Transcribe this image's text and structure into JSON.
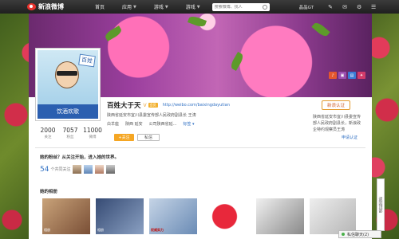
{
  "topbar": {
    "logo": "新浪微博",
    "nav": [
      {
        "label": "首页",
        "caret": false
      },
      {
        "label": "应用",
        "caret": true
      },
      {
        "label": "游戏",
        "caret": true
      },
      {
        "label": "游戏",
        "caret": true
      }
    ],
    "search_placeholder": "搜索微博、找人",
    "user": "晶晶GT",
    "icons": [
      "edit-icon",
      "mail-icon",
      "gear-icon",
      "list-icon"
    ]
  },
  "profile": {
    "avatar_caption": "饮酒欢歌",
    "avatar_tag": "百姓",
    "name": "百姓大于天",
    "vip_mark": "V",
    "vip_badge": "会员",
    "url": "http://weibo.com/baixingdayutian",
    "desc": "陕西省延安市宜川县委宣传部人民政府副县长 王涛",
    "meta": [
      {
        "label": "白羊座",
        "link": false
      },
      {
        "label": "陕西 延安",
        "link": false
      },
      {
        "label": "公司陕西省延...",
        "link": false
      },
      {
        "label": "标签 ▾",
        "link": true
      }
    ]
  },
  "stats": [
    {
      "num": "2000",
      "label": "关注"
    },
    {
      "num": "7057",
      "label": "粉丝"
    },
    {
      "num": "11000",
      "label": "微博"
    }
  ],
  "buttons": {
    "follow": "+关注",
    "message": "私信"
  },
  "verify": {
    "button": "新浪认证",
    "text": "陕西省延安市宜川县委宣传部人民政府副县长，新浪政企特约观察员王涛",
    "link": "申请认证"
  },
  "follow_prompt": "她的粉丝？从关注开始，进入她的世界。",
  "common": {
    "count": "54",
    "label": "个共同关注"
  },
  "section_title": "她的相册",
  "photos": [
    {
      "label": "相册"
    },
    {
      "label": "相册"
    },
    {
      "label": "权威实力"
    },
    {
      "label": ""
    },
    {
      "label": ""
    },
    {
      "label": ""
    },
    {
      "label": ""
    }
  ],
  "side_tab": "返回顶部",
  "chat": "私信聊天(2)",
  "colors": {
    "accent": "#3372c4",
    "orange": "#f5a623",
    "avatar_bg": "#2b5fb0"
  }
}
